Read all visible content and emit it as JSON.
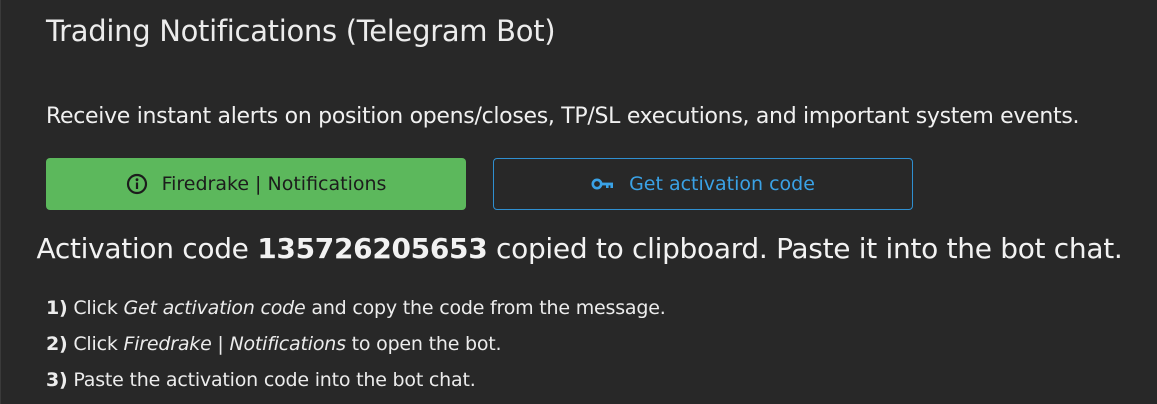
{
  "title": "Trading Notifications (Telegram Bot)",
  "description": "Receive instant alerts on position opens/closes, TP/SL executions, and important system events.",
  "buttons": {
    "bot": {
      "label": "Firedrake | Notifications",
      "icon": "info-circle-icon",
      "color": "#5cb85c"
    },
    "activation": {
      "label": "Get activation code",
      "icon": "key-icon",
      "color": "#3aa2e6"
    }
  },
  "activation_message": {
    "prefix": "Activation code ",
    "code": "135726205653",
    "suffix": " copied to clipboard. Paste it into the bot chat."
  },
  "steps": [
    {
      "num": "1)",
      "pre": " Click ",
      "em": "Get activation code",
      "post": " and copy the code from the message."
    },
    {
      "num": "2)",
      "pre": " Click ",
      "em": "Firedrake | Notifications",
      "post": " to open the bot."
    },
    {
      "num": "3)",
      "pre": " Paste the activation code into the bot chat.",
      "em": "",
      "post": ""
    }
  ]
}
